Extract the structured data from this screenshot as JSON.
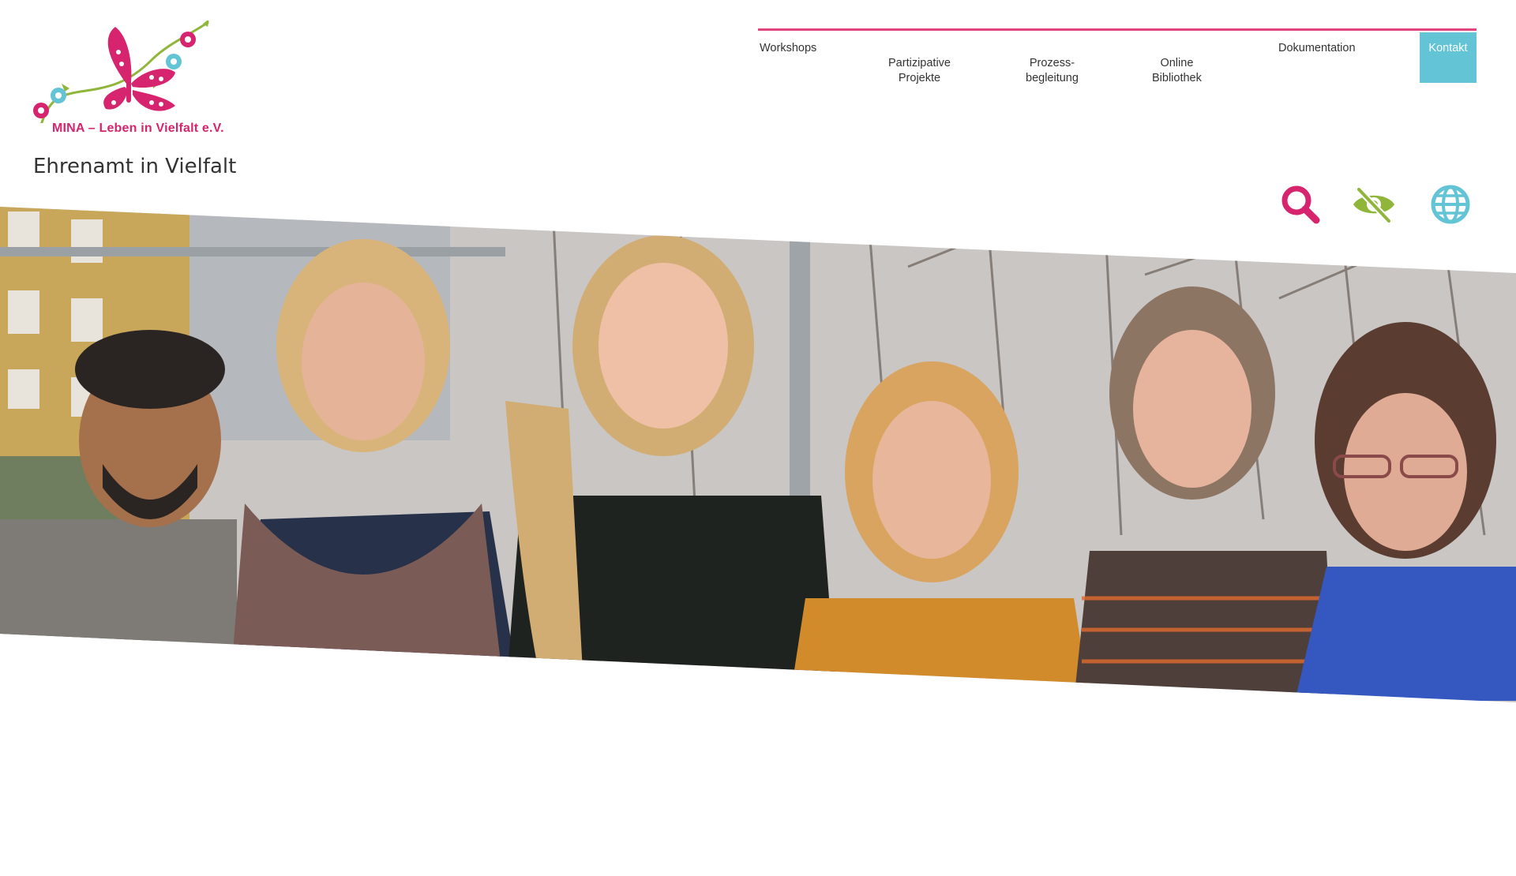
{
  "brand": {
    "logo_text": "MINA – Leben in Vielfalt e.V.",
    "tagline": "Ehrenamt in Vielfalt",
    "colors": {
      "pink": "#d6246e",
      "blue": "#62c4d4",
      "green": "#8fb63a"
    }
  },
  "nav": {
    "items": [
      {
        "label": "Workshops"
      },
      {
        "label": "Partizipative\nProjekte"
      },
      {
        "label": "Prozess-\nbegleitung"
      },
      {
        "label": "Online\nBibliothek"
      },
      {
        "label": "Dokumentation"
      },
      {
        "label": "Kontakt",
        "active": true
      }
    ]
  },
  "utilities": {
    "search_icon": "search-icon",
    "accessibility_icon": "eye-slash-icon",
    "language_icon": "globe-icon"
  },
  "hero": {
    "image_description_icon": "group-photo"
  }
}
